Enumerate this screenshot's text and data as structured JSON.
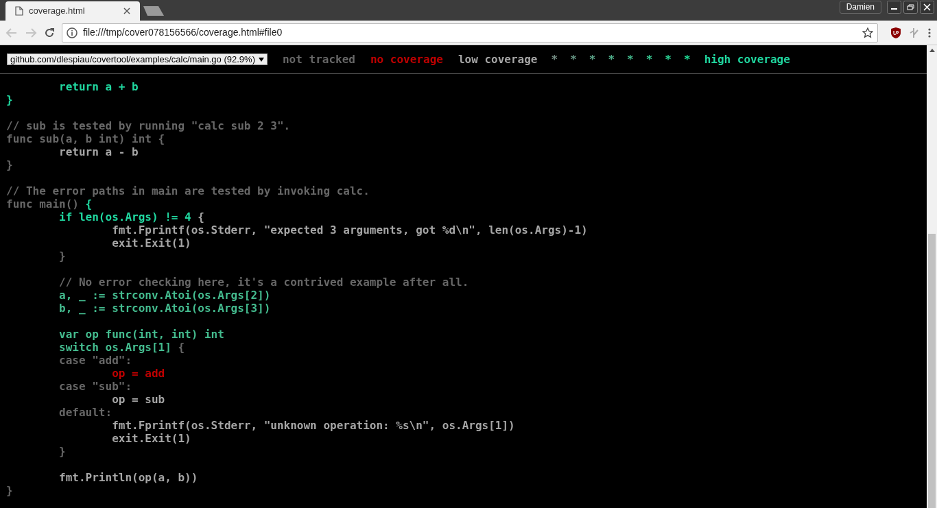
{
  "browser": {
    "tab_title": "coverage.html",
    "profile": "Damien",
    "url": "file:///tmp/cover078156566/coverage.html#file0"
  },
  "topbar": {
    "file_select": "github.com/dlespiau/covertool/examples/calc/main.go (92.9%)",
    "legend": [
      {
        "text": "not tracked",
        "color": "#676767"
      },
      {
        "text": "no coverage",
        "color": "#c00000"
      },
      {
        "text": "low coverage",
        "color": "#a6a6a6"
      },
      {
        "text": "*",
        "color": "#748c83"
      },
      {
        "text": "*",
        "color": "#689886"
      },
      {
        "text": "*",
        "color": "#5ca489"
      },
      {
        "text": "*",
        "color": "#50b08c"
      },
      {
        "text": "*",
        "color": "#44bc8f"
      },
      {
        "text": "*",
        "color": "#38c892"
      },
      {
        "text": "*",
        "color": "#2cd495"
      },
      {
        "text": "*",
        "color": "#20e098"
      },
      {
        "text": "high coverage",
        "color": "#20d8a0"
      }
    ]
  },
  "code_blocks": [
    {
      "lines": [
        {
          "segments": [
            {
              "text": "\treturn a + b",
              "color": "#20d8a0"
            }
          ]
        },
        {
          "segments": [
            {
              "text": "}",
              "color": "#20d8a0"
            }
          ]
        }
      ]
    },
    {
      "lines": [
        {
          "segments": [
            {
              "text": "// sub is tested by running \"calc sub 2 3\".",
              "color": "#676767"
            }
          ]
        },
        {
          "segments": [
            {
              "text": "func sub(a, b int) int {",
              "color": "#676767"
            }
          ]
        },
        {
          "segments": [
            {
              "text": "\treturn a - b",
              "color": "#a6a6a6"
            }
          ]
        },
        {
          "segments": [
            {
              "text": "}",
              "color": "#676767"
            }
          ]
        }
      ]
    },
    {
      "lines": [
        {
          "segments": [
            {
              "text": "// The error paths in main are tested by invoking calc.",
              "color": "#676767"
            }
          ]
        },
        {
          "segments": [
            {
              "text": "func main() ",
              "color": "#676767"
            },
            {
              "text": "{",
              "color": "#20d8a0"
            }
          ]
        },
        {
          "segments": [
            {
              "text": "\tif len(os.Args) != 4",
              "color": "#20d8a0"
            },
            {
              "text": " {",
              "color": "#a6a6a6"
            }
          ]
        },
        {
          "segments": [
            {
              "text": "\t\tfmt.Fprintf(os.Stderr, \"expected 3 arguments, got %d\\n\", len(os.Args)-1)",
              "color": "#a6a6a6"
            }
          ]
        },
        {
          "segments": [
            {
              "text": "\t\texit.Exit(1)",
              "color": "#a6a6a6"
            }
          ]
        },
        {
          "segments": [
            {
              "text": "\t}",
              "color": "#676767"
            }
          ]
        }
      ]
    },
    {
      "lines": [
        {
          "segments": [
            {
              "text": "\t// No error checking here, it's a contrived example after all.",
              "color": "#676767"
            }
          ]
        },
        {
          "segments": [
            {
              "text": "\ta, _ := strconv.Atoi(os.Args[2])",
              "color": "#44bc8f"
            }
          ]
        },
        {
          "segments": [
            {
              "text": "\tb, _ := strconv.Atoi(os.Args[3])",
              "color": "#44bc8f"
            }
          ]
        }
      ]
    },
    {
      "lines": [
        {
          "segments": [
            {
              "text": "\tvar op func(int, int) int",
              "color": "#44bc8f"
            }
          ]
        },
        {
          "segments": [
            {
              "text": "\tswitch os.Args[1]",
              "color": "#44bc8f"
            },
            {
              "text": " {",
              "color": "#676767"
            }
          ]
        },
        {
          "segments": [
            {
              "text": "\tcase \"add\":",
              "color": "#676767"
            }
          ]
        },
        {
          "segments": [
            {
              "text": "\t\top = add",
              "color": "#c00000"
            }
          ]
        },
        {
          "segments": [
            {
              "text": "\tcase \"sub\":",
              "color": "#676767"
            }
          ]
        },
        {
          "segments": [
            {
              "text": "\t\top = sub",
              "color": "#a6a6a6"
            }
          ]
        },
        {
          "segments": [
            {
              "text": "\tdefault:",
              "color": "#676767"
            }
          ]
        },
        {
          "segments": [
            {
              "text": "\t\tfmt.Fprintf(os.Stderr, \"unknown operation: %s\\n\", os.Args[1])",
              "color": "#a6a6a6"
            }
          ]
        },
        {
          "segments": [
            {
              "text": "\t\texit.Exit(1)",
              "color": "#a6a6a6"
            }
          ]
        },
        {
          "segments": [
            {
              "text": "\t}",
              "color": "#676767"
            }
          ]
        }
      ]
    },
    {
      "lines": [
        {
          "segments": [
            {
              "text": "\tfmt.Println(op(a, b))",
              "color": "#a6a6a6"
            }
          ]
        },
        {
          "segments": [
            {
              "text": "}",
              "color": "#676767"
            }
          ]
        }
      ]
    }
  ]
}
